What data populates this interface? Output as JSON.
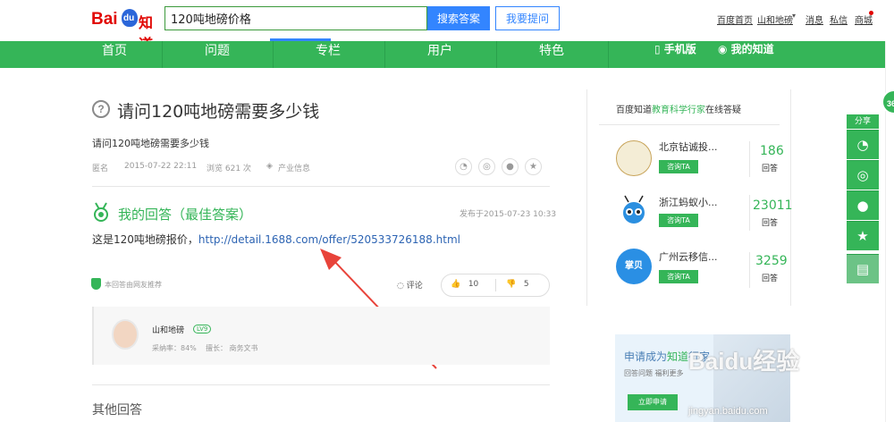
{
  "header": {
    "logo_bai": "Bai",
    "logo_du": "du",
    "logo_zhidao": "知道",
    "search_value": "120吨地磅价格",
    "search_button": "搜索答案",
    "ask_button": "我要提问",
    "links": [
      "百度首页",
      "山和地磅",
      "消息",
      "私信",
      "商城"
    ]
  },
  "nav": {
    "items": [
      "首页",
      "问题",
      "专栏",
      "用户",
      "特色"
    ],
    "mobile": "手机版",
    "my_zhidao": "我的知道"
  },
  "question": {
    "title": "请问120吨地磅需要多少钱",
    "description": "请问120吨地磅需要多少钱",
    "author": "匿名",
    "date": "2015-07-22 22:11",
    "views": "浏览 621 次",
    "category": "产业信息"
  },
  "answer": {
    "heading": "我的回答（最佳答案）",
    "published": "发布于2015-07-23 10:33",
    "text_prefix": "这是120吨地磅报价，",
    "link": "http://detail.1688.com/offer/520533726188.html",
    "recommend": "本回答由网友推荐",
    "comment_label": "评论",
    "up_votes": "10",
    "down_votes": "5",
    "user": {
      "name": "山和地磅",
      "level": "LV9",
      "adoption": "采纳率：84%",
      "expertise": "擅长：  商务文书"
    }
  },
  "other_answers": "其他回答",
  "sidebar": {
    "title_prefix": "百度知道",
    "title_highlight": "教育科学行家",
    "title_suffix": "在线答疑",
    "consult_label": "咨询TA",
    "answers_label": "回答",
    "experts": [
      {
        "name": "北京钻诚投...",
        "count": "186"
      },
      {
        "name": "浙江蚂蚁小...",
        "count": "23011"
      },
      {
        "name": "广州云移信...",
        "count": "3259"
      }
    ],
    "promo": {
      "title_prefix": "申请成为",
      "title_highlight": "知道",
      "title_suffix": "行家",
      "subtitle": "回答问题  福利更多",
      "button": "立即申请",
      "watermark": "Baidu经验",
      "watermark_url": "jingyan.baidu.com"
    }
  },
  "share": {
    "label": "分享",
    "badge": "36"
  },
  "colors": {
    "brand_green": "#35b558",
    "search_blue": "#3385ff",
    "arrow_red": "#e8433a"
  }
}
